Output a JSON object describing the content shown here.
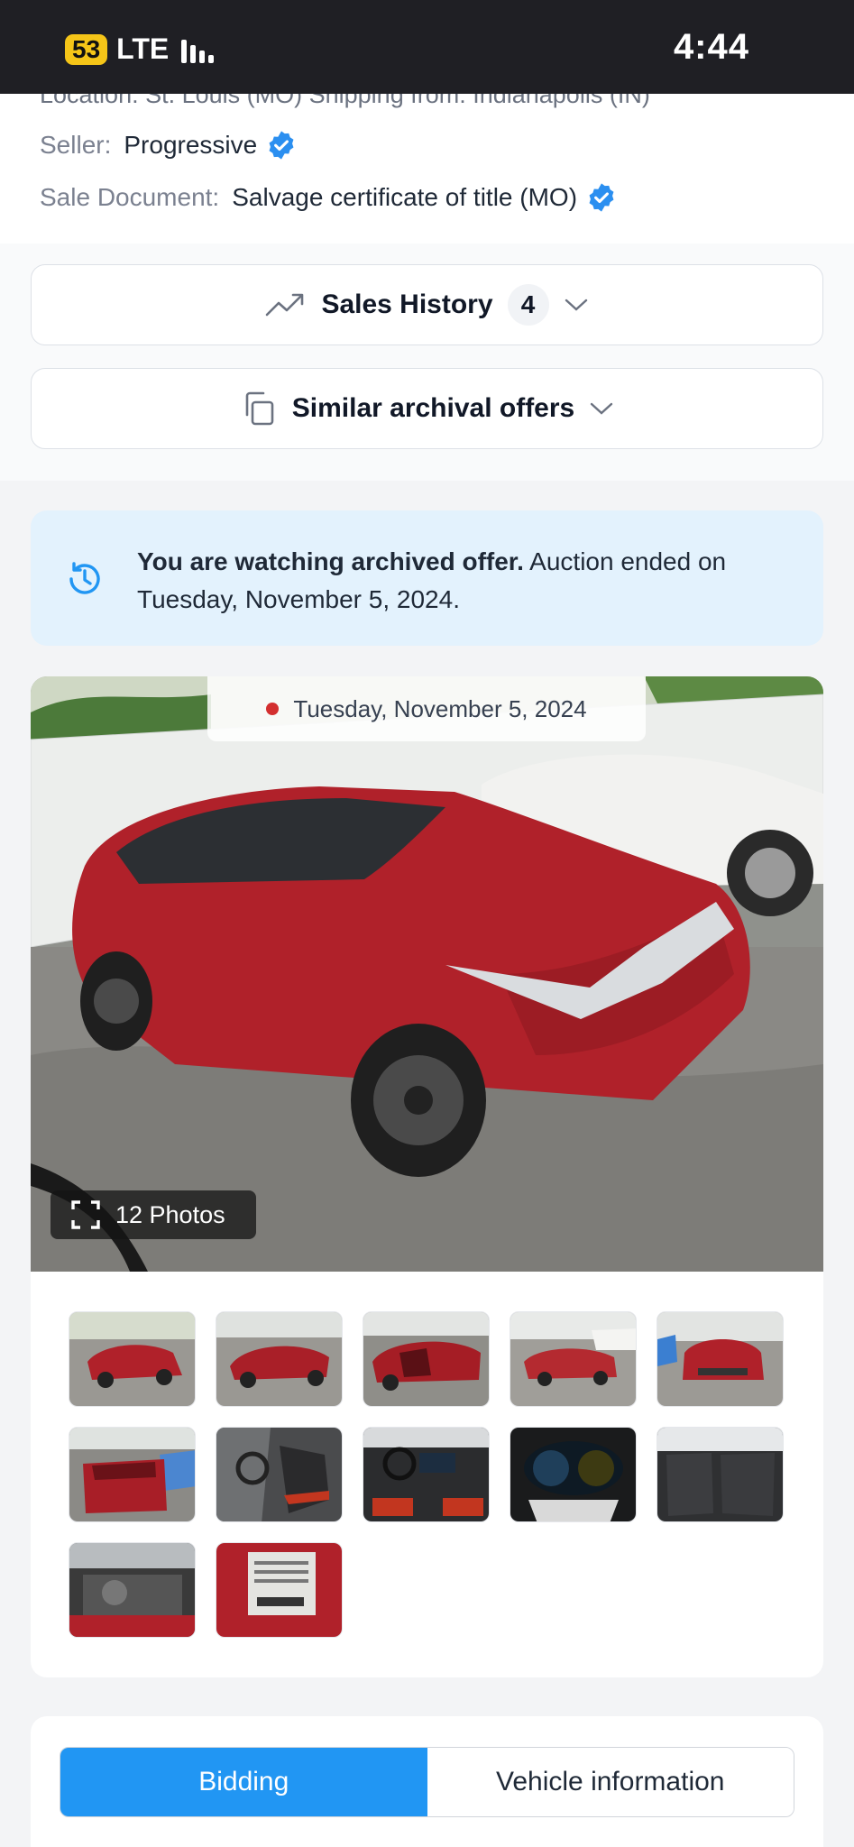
{
  "status_bar": {
    "battery": "53",
    "network": "LTE",
    "time": "4:44"
  },
  "details": {
    "cut_off_row": "Location: St. Louis (MO)   Shipping from: Indianapolis (IN)",
    "seller_label": "Seller:",
    "seller_value": "Progressive",
    "sale_doc_label": "Sale Document:",
    "sale_doc_value": "Salvage certificate of title (MO)"
  },
  "sales_history": {
    "title": "Sales History",
    "count": "4"
  },
  "similar_offers": {
    "title": "Similar archival offers"
  },
  "notice": {
    "bold": "You are watching archived offer.",
    "rest": " Auction ended on Tuesday, November 5, 2024."
  },
  "gallery": {
    "date": "Tuesday, November 5, 2024",
    "photos_label": "12 Photos",
    "thumbnail_count": 12
  },
  "tabs": {
    "bidding": "Bidding",
    "vehicle_info": "Vehicle information"
  },
  "colors": {
    "accent": "#2196f3",
    "notice_bg": "#e3f2fd",
    "verified": "#2b8ff0",
    "car_red": "#b0212a"
  }
}
